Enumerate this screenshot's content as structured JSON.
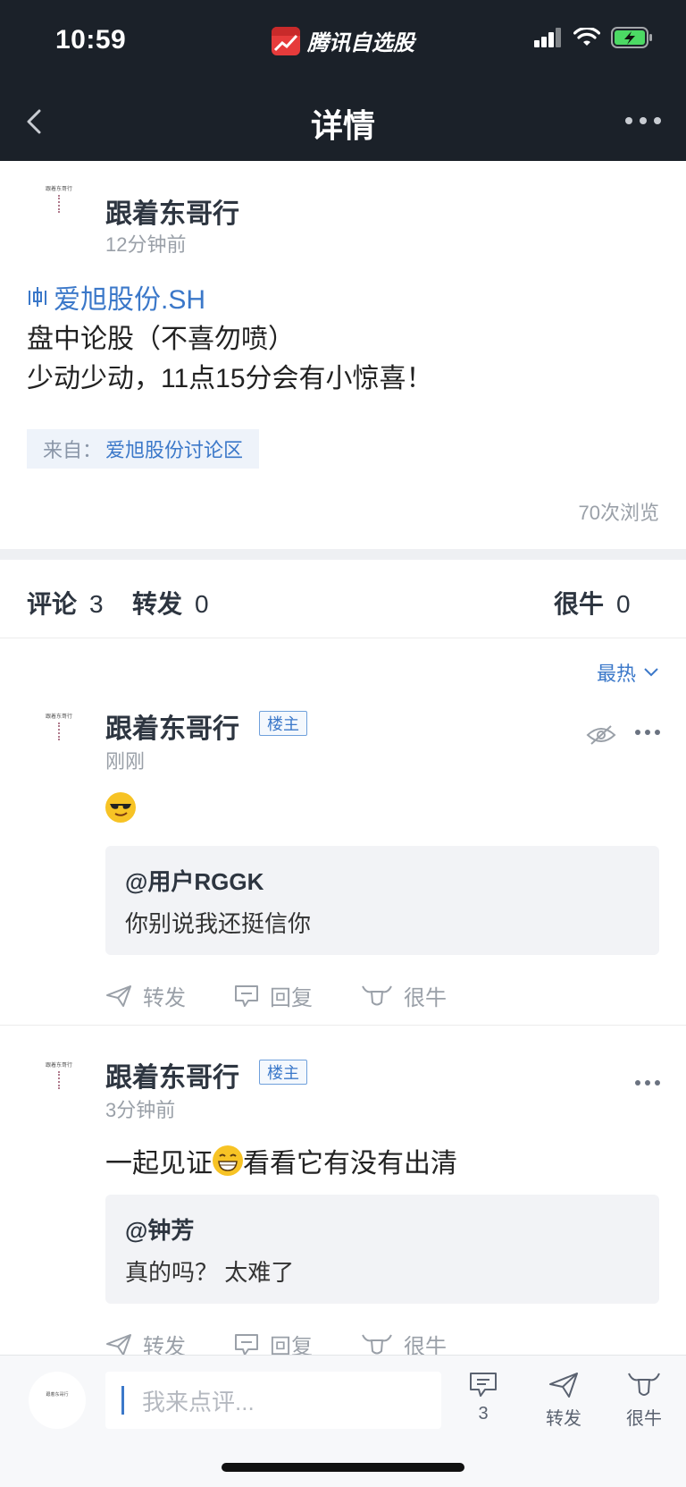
{
  "status_bar": {
    "time": "10:59",
    "app_name": "腾讯自选股"
  },
  "navbar": {
    "title": "详情"
  },
  "post": {
    "author": "跟着东哥行",
    "time": "12分钟前",
    "stock": "爱旭股份.SH",
    "lines": [
      "盘中论股（不喜勿喷）",
      "少动少动，11点15分会有小惊喜！"
    ],
    "source_prefix": "来自：",
    "source_name": "爱旭股份讨论区",
    "views": "70次浏览",
    "avatar_text": "跟着东哥行"
  },
  "tabs": {
    "comments_label": "评论",
    "comments_count": "3",
    "reposts_label": "转发",
    "reposts_count": "0",
    "likes_label": "很牛",
    "likes_count": "0"
  },
  "sort_label": "最热",
  "comments": [
    {
      "author": "跟着东哥行",
      "badge": "楼主",
      "time": "刚刚",
      "text_before": "",
      "text_after": "",
      "emoji": "cool-emoji",
      "quote_user": "@用户RGGK",
      "quote_text": "你别说我还挺信你",
      "actions": [
        "转发",
        "回复",
        "很牛"
      ]
    },
    {
      "author": "跟着东哥行",
      "badge": "楼主",
      "time": "3分钟前",
      "text_before": "一起见证",
      "text_after": "看看它有没有出清",
      "emoji": "grin-emoji",
      "quote_user": "@钟芳",
      "quote_text": "真的吗？ 太难了",
      "actions": [
        "转发",
        "回复",
        "很牛"
      ]
    }
  ],
  "bottom_bar": {
    "input_placeholder": "我来点评...",
    "comment_count": "3",
    "repost_label": "转发",
    "like_label": "很牛"
  },
  "colors": {
    "accent": "#3b78c9",
    "header_bg": "#1b2129",
    "battery": "#4cd964"
  }
}
